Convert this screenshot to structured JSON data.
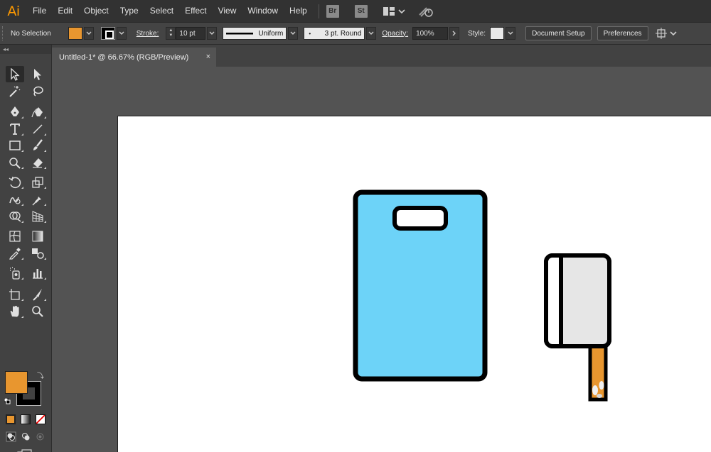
{
  "app": {
    "logo": "Ai",
    "accent": "#ff9a00"
  },
  "menu": [
    "File",
    "Edit",
    "Object",
    "Type",
    "Select",
    "Effect",
    "View",
    "Window",
    "Help"
  ],
  "bridge_badge": "Br",
  "stock_badge": "St",
  "control": {
    "selection": "No Selection",
    "fill_color": "#e8962f",
    "stroke_label": "Stroke:",
    "stroke_value": "10 pt",
    "profile_label": "Uniform",
    "brush_label": "3 pt. Round",
    "opacity_label": "Opacity:",
    "opacity_value": "100%",
    "style_label": "Style:",
    "doc_setup": "Document Setup",
    "preferences": "Preferences"
  },
  "document": {
    "tab_title": "Untitled-1* @ 66.67% (RGB/Preview)",
    "close": "×"
  },
  "colors": {
    "fill": "#e8962f",
    "stroke": "#000000",
    "board": "#6dd3f8",
    "cleaver_blade": "#e6e6e6",
    "cleaver_handle": "#e8962f"
  },
  "tools": [
    [
      "selection-tool",
      "direct-selection-tool"
    ],
    [
      "magic-wand-tool",
      "lasso-tool"
    ],
    [
      "pen-tool",
      "curvature-tool"
    ],
    [
      "type-tool",
      "line-segment-tool"
    ],
    [
      "rectangle-tool",
      "paintbrush-tool"
    ],
    [
      "shaper-tool",
      "eraser-tool"
    ],
    [
      "rotate-tool",
      "scale-tool"
    ],
    [
      "warp-tool",
      "puppet-warp-tool"
    ],
    [
      "shape-builder-tool",
      "perspective-grid-tool"
    ],
    [
      "mesh-tool",
      "gradient-tool"
    ],
    [
      "eyedropper-tool",
      "blend-tool"
    ],
    [
      "symbol-sprayer-tool",
      "column-graph-tool"
    ],
    [
      "artboard-tool",
      "slice-tool"
    ],
    [
      "hand-tool",
      "zoom-tool"
    ]
  ]
}
